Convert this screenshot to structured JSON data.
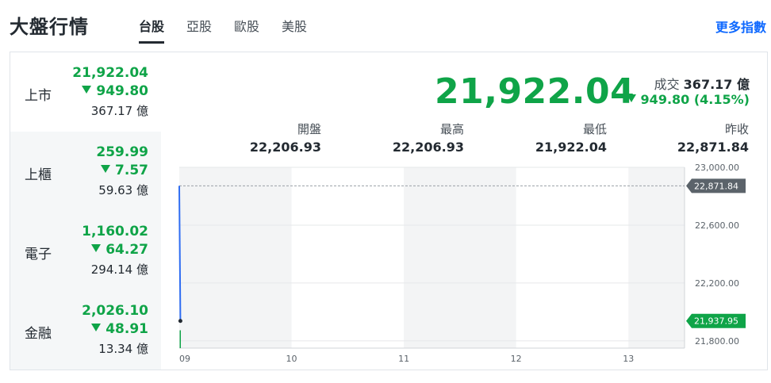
{
  "header": {
    "title": "大盤行情",
    "tabs": [
      {
        "label": "台股",
        "active": true
      },
      {
        "label": "亞股",
        "active": false
      },
      {
        "label": "歐股",
        "active": false
      },
      {
        "label": "美股",
        "active": false
      }
    ],
    "more_link": "更多指數"
  },
  "sidebar": {
    "markets": [
      {
        "name": "上市",
        "value": "21,922.04",
        "change": "949.80",
        "volume": "367.17 億",
        "direction": "down",
        "active": true
      },
      {
        "name": "上櫃",
        "value": "259.99",
        "change": "7.57",
        "volume": "59.63 億",
        "direction": "down",
        "active": false
      },
      {
        "name": "電子",
        "value": "1,160.02",
        "change": "64.27",
        "volume": "294.14 億",
        "direction": "down",
        "active": false
      },
      {
        "name": "金融",
        "value": "2,026.10",
        "change": "48.91",
        "volume": "13.34 億",
        "direction": "down",
        "active": false
      }
    ]
  },
  "main": {
    "index_value": "21,922.04",
    "turnover_label": "成交",
    "turnover_value": "367.17 億",
    "change_text": "949.80 (4.15%)",
    "stats": [
      {
        "label": "開盤",
        "value": "22,206.93"
      },
      {
        "label": "最高",
        "value": "22,206.93"
      },
      {
        "label": "最低",
        "value": "21,922.04"
      },
      {
        "label": "昨收",
        "value": "22,871.84"
      }
    ]
  },
  "colors": {
    "down": "#0fa448",
    "accent": "#0f69ff",
    "line": "#2f6df2",
    "ref_tag": "#5b636a"
  },
  "chart_data": {
    "type": "line",
    "x_ticks": [
      "09",
      "10",
      "11",
      "12",
      "13"
    ],
    "y_ticks": [
      "23,000.00",
      "22,600.00",
      "22,200.00",
      "21,800.00"
    ],
    "ylim": [
      21750,
      23000
    ],
    "series": [
      {
        "x": [
          9.0,
          9.01
        ],
        "values": [
          22871.84,
          21937.95
        ]
      }
    ],
    "reference_label": "22,871.84",
    "reference_value": 22871.84,
    "current_label": "21,937.95",
    "current_value": 21937.95,
    "volume_bar": 0.15,
    "grid": true
  }
}
